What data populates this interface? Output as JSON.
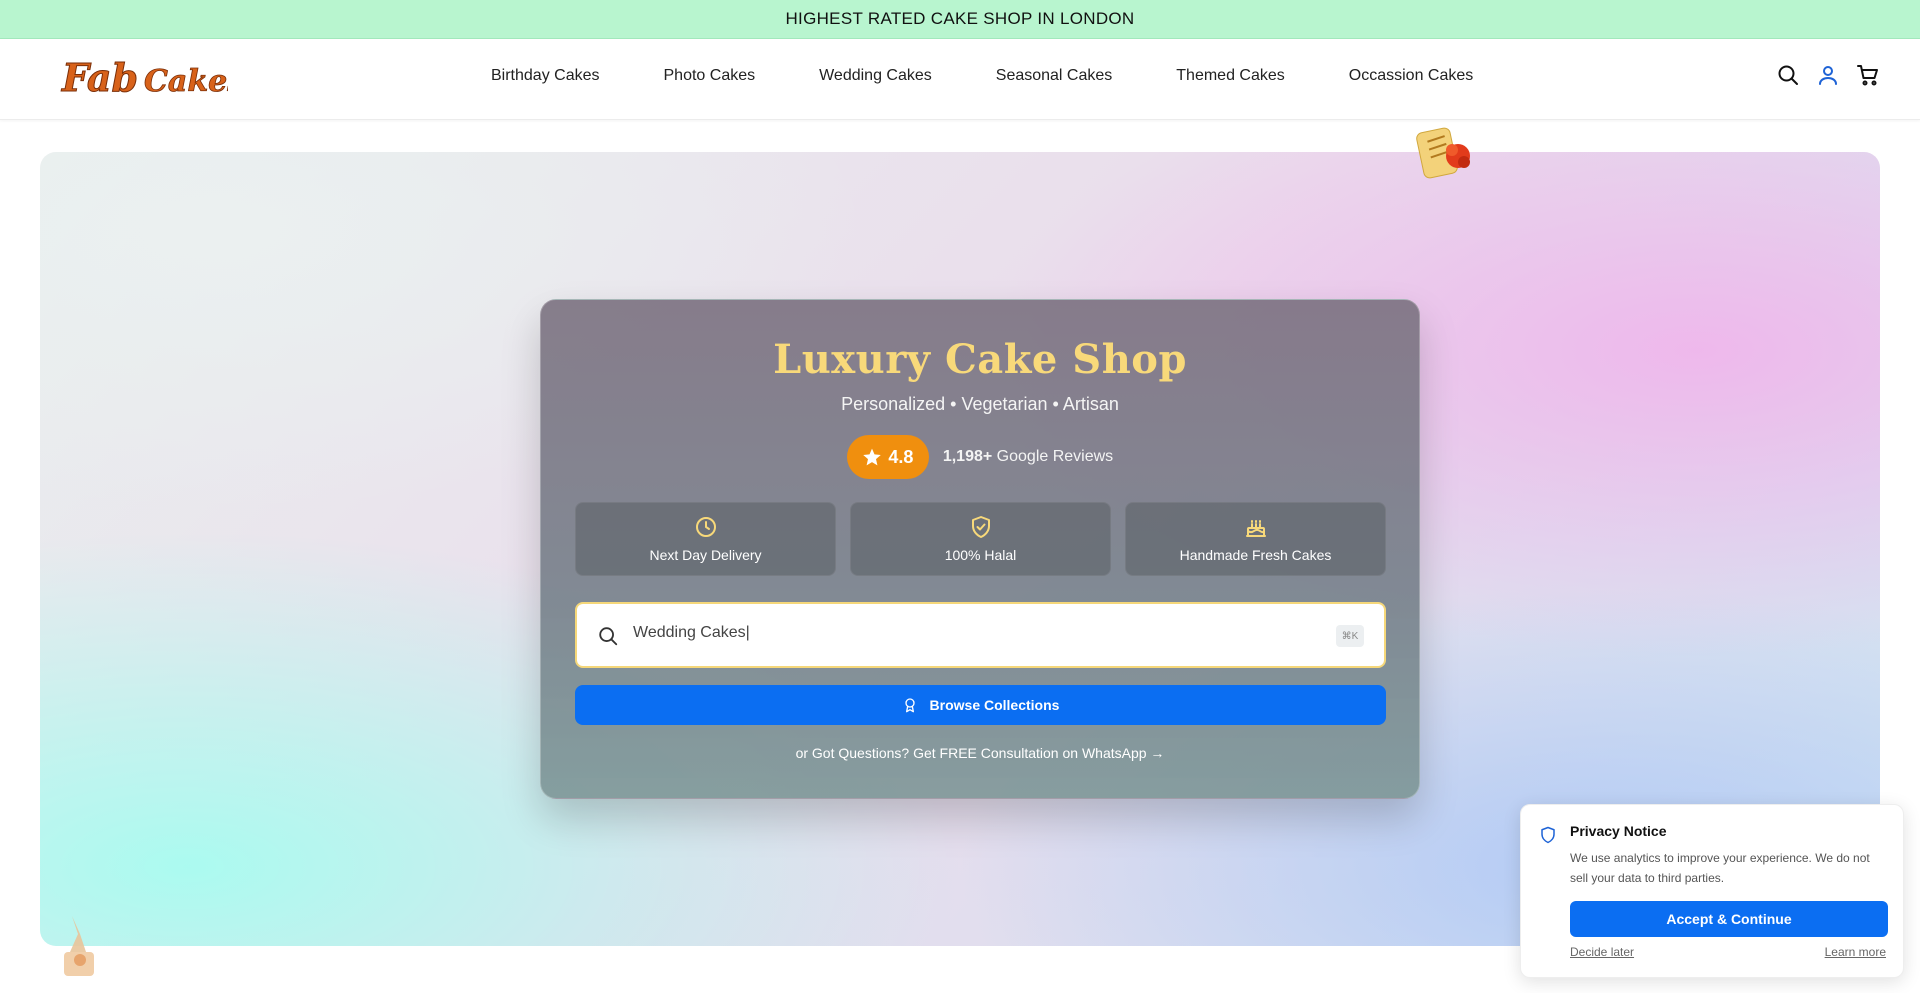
{
  "banner": {
    "text": "HIGHEST RATED CAKE SHOP IN LONDON"
  },
  "header": {
    "logo_text": "Fab Cakes",
    "nav": [
      {
        "label": "Birthday Cakes"
      },
      {
        "label": "Photo Cakes"
      },
      {
        "label": "Wedding Cakes"
      },
      {
        "label": "Seasonal Cakes"
      },
      {
        "label": "Themed Cakes"
      },
      {
        "label": "Occassion Cakes"
      }
    ],
    "icons": [
      "search-icon",
      "user-icon",
      "cart-icon"
    ]
  },
  "hero": {
    "title": "Luxury Cake Shop",
    "subtitle": "Personalized • Vegetarian • Artisan",
    "rating": {
      "value": "4.8",
      "count": "1,198+",
      "label": "Google Reviews"
    },
    "features": [
      {
        "icon": "clock-icon",
        "label": "Next Day Delivery"
      },
      {
        "icon": "shield-check-icon",
        "label": "100% Halal"
      },
      {
        "icon": "cake-icon",
        "label": "Handmade Fresh Cakes"
      }
    ],
    "search": {
      "value": "Wedding Cakes|",
      "shortcut": "⌘K"
    },
    "browse_label": "Browse Collections",
    "consult_text": "or Got Questions? Get FREE Consultation on WhatsApp →"
  },
  "privacy": {
    "title": "Privacy Notice",
    "text": "We use analytics to improve your experience. We do not sell your data to third parties.",
    "accept_label": "Accept & Continue",
    "decide_later": "Decide later",
    "learn_more": "Learn more"
  },
  "colors": {
    "banner_bg": "#b8f5cf",
    "title_gold": "#f8d97a",
    "rating_orange": "#f08f0e",
    "primary_blue": "#0b6ef2"
  }
}
